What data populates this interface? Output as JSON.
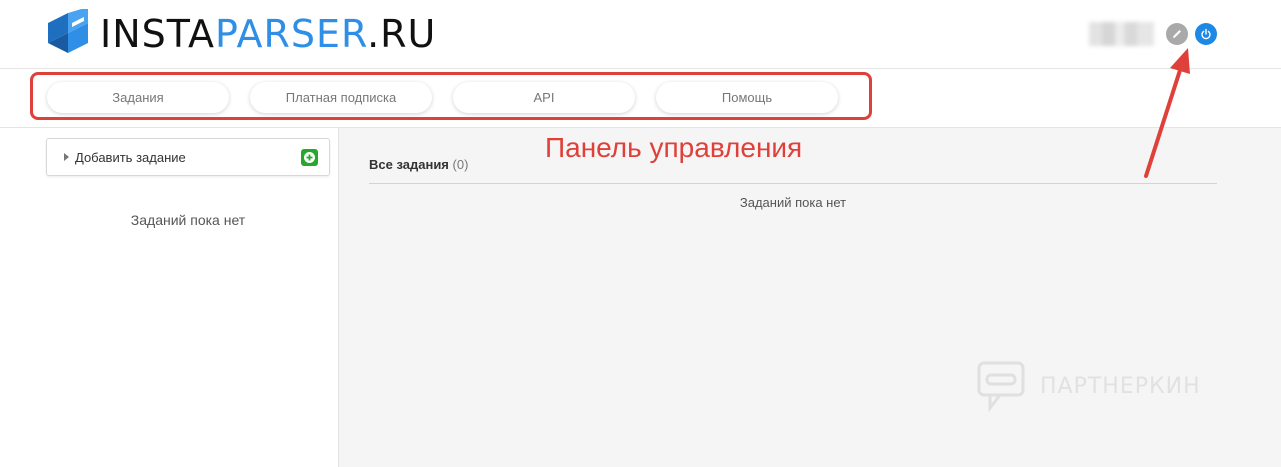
{
  "header": {
    "logo": {
      "part1": "INSTA",
      "part2": "PARSER",
      "part3": ".RU"
    },
    "edit_icon": "pencil-icon",
    "power_icon": "power-icon",
    "colors": {
      "brand_blue": "#2f8fe6",
      "power_blue": "#1e88e5",
      "edit_gray": "#a9a9a9"
    }
  },
  "nav": {
    "tabs": [
      {
        "label": "Задания"
      },
      {
        "label": "Платная подписка"
      },
      {
        "label": "API"
      },
      {
        "label": "Помощь"
      }
    ]
  },
  "annotation": {
    "label": "Панель управления",
    "color": "#e0403a"
  },
  "sidebar": {
    "add_task_label": "Добавить задание",
    "add_icon": "plus-icon",
    "empty_text": "Заданий пока нет",
    "plus_color": "#27a82c"
  },
  "main": {
    "title": "Все задания",
    "count": "(0)",
    "empty_text": "Заданий пока нет"
  },
  "watermark": {
    "text": "ПАРТНЕРКИН"
  }
}
